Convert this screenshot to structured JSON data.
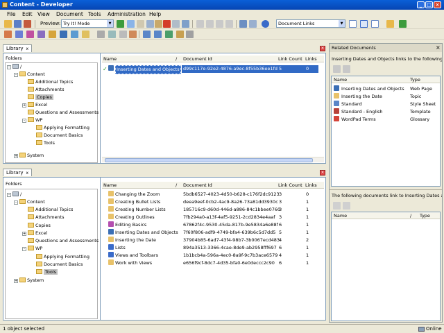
{
  "window": {
    "title": "Content - Developer"
  },
  "menu": [
    "File",
    "Edit",
    "View",
    "Document",
    "Tools",
    "Administration",
    "Help"
  ],
  "toolbar": {
    "preview_label": "Preview:",
    "preview_value": "Try It! Mode",
    "doc_links_value": "Document Links"
  },
  "top_library": {
    "tab_label": "Library",
    "tab_close": "x",
    "folders_label": "Folders",
    "columns": {
      "name": "Name",
      "doc_id": "Document Id",
      "link_count": "Link Count",
      "links": "Links"
    },
    "tree": [
      {
        "label": "/",
        "kind": "root"
      },
      {
        "label": "Content",
        "kind": "folder"
      },
      {
        "label": "Additional Topics",
        "kind": "folder"
      },
      {
        "label": "Attachments",
        "kind": "folder"
      },
      {
        "label": "Copies",
        "kind": "folder",
        "selected": true
      },
      {
        "label": "Excel",
        "kind": "folder"
      },
      {
        "label": "Questions and Assessments",
        "kind": "folder"
      },
      {
        "label": "WP",
        "kind": "folder"
      },
      {
        "label": "Applying Formatting",
        "kind": "folder"
      },
      {
        "label": "Document Basics",
        "kind": "folder"
      },
      {
        "label": "Tools",
        "kind": "folder"
      },
      {
        "label": "System",
        "kind": "folder"
      }
    ],
    "rows": [
      {
        "name": "Inserting Dates and Objects",
        "doc_id": "d99c117e-92e2-4876-a9ec-8f55b36ee1fd",
        "link_count": "5",
        "links": "0"
      }
    ]
  },
  "bottom_library": {
    "tab_label": "Library",
    "tab_close": "x",
    "folders_label": "Folders",
    "columns": {
      "name": "Name",
      "doc_id": "Document Id",
      "link_count": "Link Count",
      "links": "Links"
    },
    "tree": [
      {
        "label": "/",
        "kind": "root"
      },
      {
        "label": "Content",
        "kind": "folder"
      },
      {
        "label": "Additional Topics",
        "kind": "folder"
      },
      {
        "label": "Attachments",
        "kind": "folder"
      },
      {
        "label": "Copies",
        "kind": "folder"
      },
      {
        "label": "Excel",
        "kind": "folder"
      },
      {
        "label": "Questions and Assessments",
        "kind": "folder"
      },
      {
        "label": "WP",
        "kind": "folder"
      },
      {
        "label": "Applying Formatting",
        "kind": "folder"
      },
      {
        "label": "Document Basics",
        "kind": "folder"
      },
      {
        "label": "Tools",
        "kind": "folder",
        "selected": true
      },
      {
        "label": "System",
        "kind": "folder"
      }
    ],
    "rows": [
      {
        "name": "Changing the Zoom",
        "doc_id": "5bdb6527-4023-4d50-b628-c176f2dc9123",
        "link_count": "3",
        "links": "0",
        "icon": "topic-icon"
      },
      {
        "name": "Creating Bullet Lists",
        "doc_id": "deea9eef-0cb2-4ac9-8a26-73a81dd3930c",
        "link_count": "3",
        "links": "1",
        "icon": "topic-icon"
      },
      {
        "name": "Creating Number Lists",
        "doc_id": "185716c9-d60d-446d-a886-84c1bbee0760",
        "link_count": "3",
        "links": "1",
        "icon": "topic-icon"
      },
      {
        "name": "Creating Outlines",
        "doc_id": "7fb294a0-a13f-4af5-9251-2cd2834e4aaf",
        "link_count": "3",
        "links": "1",
        "icon": "topic-icon"
      },
      {
        "name": "Editing Basics",
        "doc_id": "67862f4c-9530-45da-817b-9e5834a6e88f",
        "link_count": "6",
        "links": "1",
        "icon": "module-icon"
      },
      {
        "name": "Inserting Dates and Objects",
        "doc_id": "7f60f806-adf9-4749-bfa4-639b6c5d7dd5",
        "link_count": "5",
        "links": "1",
        "icon": "web-page-icon"
      },
      {
        "name": "Inserting the Date",
        "doc_id": "37904b85-6ad7-43f4-98b7-3b0067ecd483",
        "link_count": "4",
        "links": "2",
        "icon": "topic-icon"
      },
      {
        "name": "Lists",
        "doc_id": "894a3513-3366-4cae-8de9-ab2958fff697",
        "link_count": "6",
        "links": "1",
        "icon": "section-icon"
      },
      {
        "name": "Views and Toolbars",
        "doc_id": "1b1bcb4a-596a-4ec0-8a9f-9c7b3ace6579",
        "link_count": "4",
        "links": "1",
        "icon": "section-icon"
      },
      {
        "name": "Work with Views",
        "doc_id": "e656f9cf-8dc7-4d35-bfa0-6e0deccc2c90",
        "link_count": "6",
        "links": "1",
        "icon": "topic-icon"
      }
    ]
  },
  "related": {
    "title": "Related Documents",
    "close": "×",
    "top_heading": "Inserting Dates and Objects links to the following ...",
    "bottom_heading": "The following documents link to Inserting Dates an...",
    "columns": {
      "name": "Name",
      "type": "Type"
    },
    "rows": [
      {
        "name": "Inserting Dates and Objects",
        "type": "Web Page"
      },
      {
        "name": "Inserting the Date",
        "type": "Topic"
      },
      {
        "name": "Standard",
        "type": "Style Sheet"
      },
      {
        "name": "Standard - English",
        "type": "Template"
      },
      {
        "name": "WordPad Terms",
        "type": "Glossary"
      }
    ]
  },
  "status": {
    "left": "1 object selected",
    "right": "Online"
  }
}
